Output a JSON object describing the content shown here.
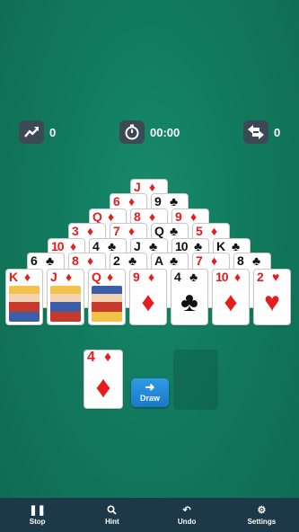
{
  "stats": {
    "score": "0",
    "timer": "00:00",
    "moves": "0"
  },
  "pyramid": [
    [
      {
        "rank": "J",
        "suit": "♦",
        "color": "red"
      }
    ],
    [
      {
        "rank": "6",
        "suit": "♦",
        "color": "red"
      },
      {
        "rank": "9",
        "suit": "♣",
        "color": "black"
      }
    ],
    [
      {
        "rank": "Q",
        "suit": "♦",
        "color": "red"
      },
      {
        "rank": "8",
        "suit": "♦",
        "color": "red"
      },
      {
        "rank": "9",
        "suit": "♦",
        "color": "red"
      }
    ],
    [
      {
        "rank": "3",
        "suit": "♦",
        "color": "red"
      },
      {
        "rank": "7",
        "suit": "♦",
        "color": "red"
      },
      {
        "rank": "Q",
        "suit": "♣",
        "color": "black"
      },
      {
        "rank": "5",
        "suit": "♦",
        "color": "red"
      }
    ],
    [
      {
        "rank": "10",
        "suit": "♦",
        "color": "red"
      },
      {
        "rank": "4",
        "suit": "♣",
        "color": "black"
      },
      {
        "rank": "J",
        "suit": "♣",
        "color": "black"
      },
      {
        "rank": "10",
        "suit": "♣",
        "color": "black"
      },
      {
        "rank": "K",
        "suit": "♣",
        "color": "black"
      }
    ],
    [
      {
        "rank": "6",
        "suit": "♣",
        "color": "black"
      },
      {
        "rank": "8",
        "suit": "♦",
        "color": "red"
      },
      {
        "rank": "2",
        "suit": "♣",
        "color": "black"
      },
      {
        "rank": "A",
        "suit": "♣",
        "color": "black"
      },
      {
        "rank": "7",
        "suit": "♦",
        "color": "red"
      },
      {
        "rank": "8",
        "suit": "♣",
        "color": "black"
      }
    ],
    [
      {
        "rank": "K",
        "suit": "♦",
        "color": "red"
      },
      {
        "rank": "J",
        "suit": "♦",
        "color": "red"
      },
      {
        "rank": "Q",
        "suit": "♦",
        "color": "red"
      },
      {
        "rank": "9",
        "suit": "♦",
        "color": "red"
      },
      {
        "rank": "4",
        "suit": "♣",
        "color": "black"
      },
      {
        "rank": "10",
        "suit": "♦",
        "color": "red"
      },
      {
        "rank": "2",
        "suit": "♥",
        "color": "red"
      }
    ]
  ],
  "waste_card": {
    "rank": "4",
    "suit": "♦",
    "color": "red"
  },
  "draw_label": "Draw",
  "bottom_bar": {
    "stop": "Stop",
    "hint": "Hint",
    "undo": "Undo",
    "settings": "Settings"
  }
}
